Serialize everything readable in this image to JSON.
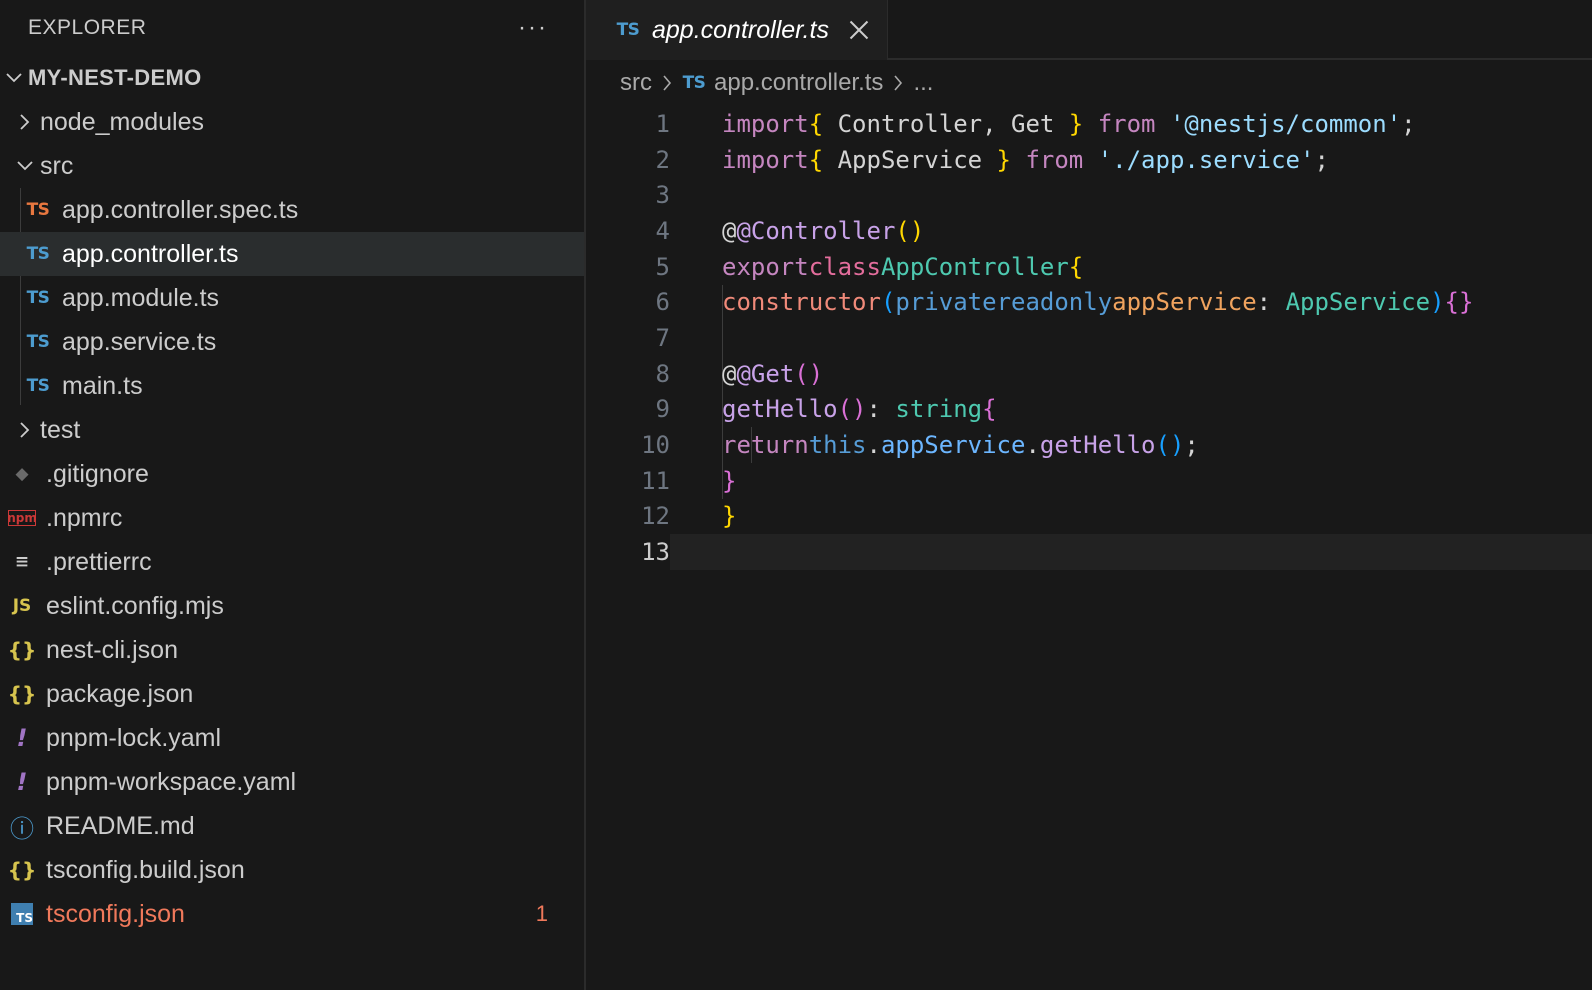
{
  "explorer": {
    "title": "EXPLORER",
    "more": "···",
    "section": "MY-NEST-DEMO",
    "items": [
      {
        "label": "node_modules",
        "type": "folder",
        "expanded": false
      },
      {
        "label": "src",
        "type": "folder",
        "expanded": true
      },
      {
        "label": "app.controller.spec.ts",
        "icon": "TS"
      },
      {
        "label": "app.controller.ts",
        "icon": "TS",
        "selected": true
      },
      {
        "label": "app.module.ts",
        "icon": "TS"
      },
      {
        "label": "app.service.ts",
        "icon": "TS"
      },
      {
        "label": "main.ts",
        "icon": "TS"
      },
      {
        "label": "test",
        "type": "folder",
        "expanded": false
      },
      {
        "label": ".gitignore",
        "icon": "◆"
      },
      {
        "label": ".npmrc",
        "icon": "npm"
      },
      {
        "label": ".prettierrc",
        "icon": "≡"
      },
      {
        "label": "eslint.config.mjs",
        "icon": "JS"
      },
      {
        "label": "nest-cli.json",
        "icon": "{}"
      },
      {
        "label": "package.json",
        "icon": "{}"
      },
      {
        "label": "pnpm-lock.yaml",
        "icon": "!"
      },
      {
        "label": "pnpm-workspace.yaml",
        "icon": "!"
      },
      {
        "label": "README.md",
        "icon": "ⓘ"
      },
      {
        "label": "tsconfig.build.json",
        "icon": "{}"
      },
      {
        "label": "tsconfig.json",
        "icon": "TS",
        "badge": "1",
        "error": true
      }
    ]
  },
  "editor": {
    "tab": {
      "icon": "TS",
      "label": "app.controller.ts"
    },
    "breadcrumb": {
      "folder": "src",
      "file_icon": "TS",
      "file": "app.controller.ts",
      "more": "..."
    },
    "line_numbers": [
      "1",
      "2",
      "3",
      "4",
      "5",
      "6",
      "7",
      "8",
      "9",
      "10",
      "11",
      "12",
      "13"
    ],
    "current_line": 13,
    "code": {
      "l1": {
        "t1": "import",
        "t2": "{",
        "t3": " Controller, Get ",
        "t4": "}",
        "t5": " from ",
        "t6": "'@nestjs/common'",
        "t7": ";"
      },
      "l2": {
        "t1": "import",
        "t2": "{",
        "t3": " AppService ",
        "t4": "}",
        "t5": " from ",
        "t6": "'./app.service'",
        "t7": ";"
      },
      "l4": {
        "t1": "@Controller",
        "t2": "()"
      },
      "l5": {
        "t1": "export",
        "t2": "class",
        "t3": "AppController",
        "t4": "{"
      },
      "l6": {
        "t1": "constructor",
        "t2": "(",
        "t3": "private",
        "t4": "readonly",
        "t5": "appService",
        "t6": ": ",
        "t7": "AppService",
        "t8": ")",
        "t9": "{}"
      },
      "l8": {
        "t1": "@Get",
        "t2": "()"
      },
      "l9": {
        "t1": "getHello",
        "t2": "()",
        "t3": ": ",
        "t4": "string",
        "t5": "{"
      },
      "l10": {
        "t1": "return",
        "t2": "this",
        "t3": ".",
        "t4": "appService",
        "t5": ".",
        "t6": "getHello",
        "t7": "()",
        "t8": ";"
      },
      "l11": {
        "t1": "}"
      },
      "l12": {
        "t1": "}"
      }
    }
  }
}
